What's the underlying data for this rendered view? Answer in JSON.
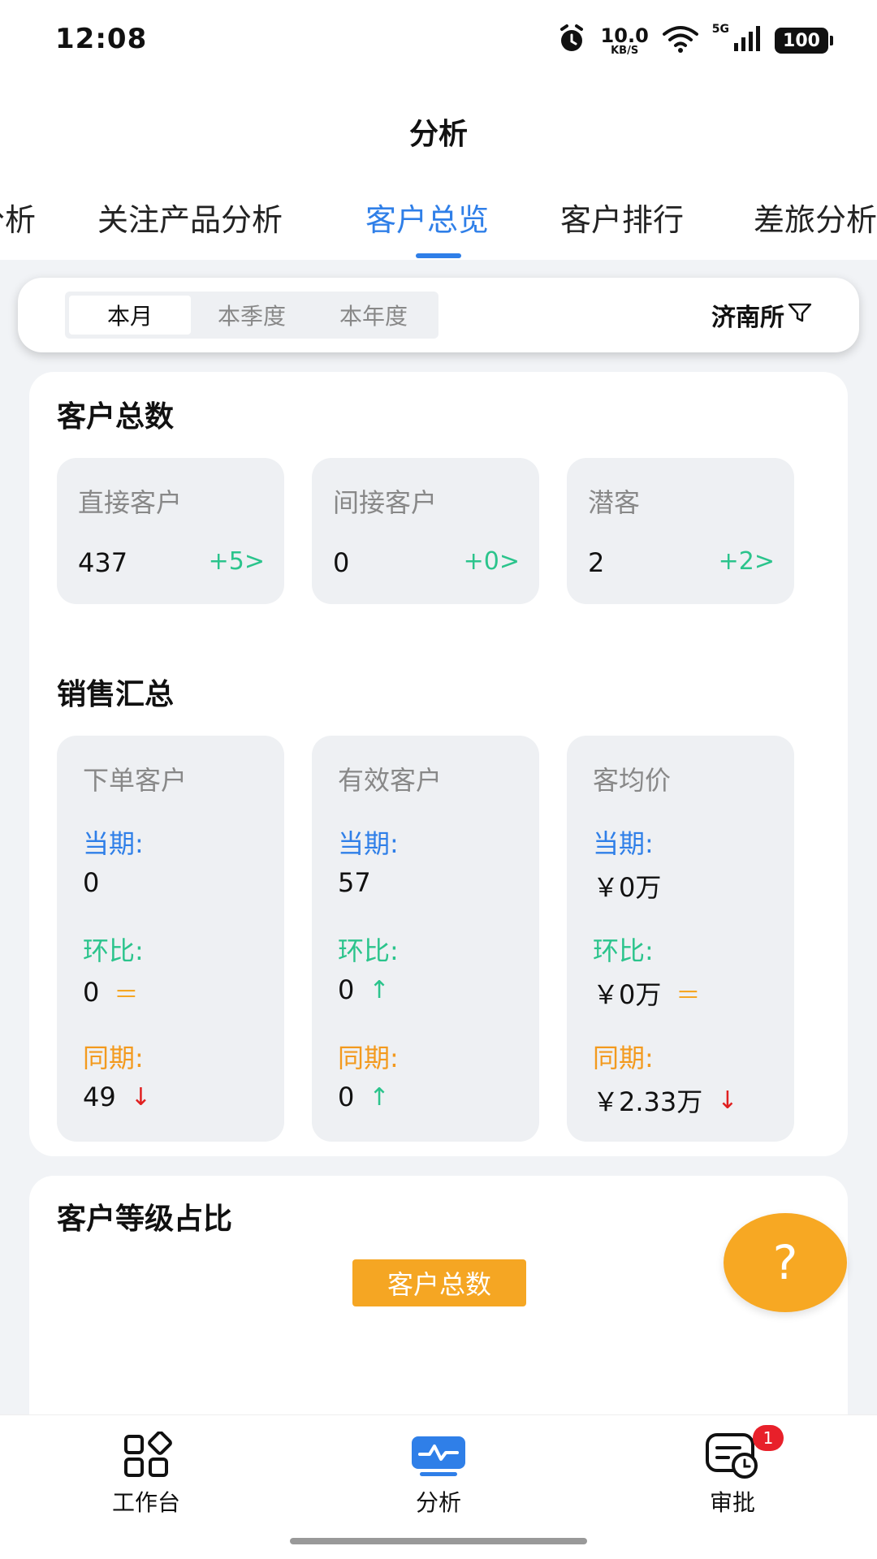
{
  "status_bar": {
    "time": "12:08",
    "net_speed_value": "10.0",
    "net_speed_unit": "KB/S",
    "signal_label": "5G",
    "battery": "100",
    "icons": [
      "alarm-icon",
      "wifi-icon",
      "signal-icon",
      "battery-icon"
    ]
  },
  "header": {
    "title": "分析",
    "tabs": [
      {
        "label": "分析",
        "active": false
      },
      {
        "label": "关注产品分析",
        "active": false
      },
      {
        "label": "客户总览",
        "active": true
      },
      {
        "label": "客户排行",
        "active": false
      },
      {
        "label": "差旅分析",
        "active": false
      }
    ]
  },
  "filter": {
    "periods": [
      "本月",
      "本季度",
      "本年度"
    ],
    "selected_period": "本月",
    "office": "济南所"
  },
  "customer_total": {
    "title": "客户总数",
    "items": [
      {
        "label": "直接客户",
        "value": "437",
        "delta": "+5>"
      },
      {
        "label": "间接客户",
        "value": "0",
        "delta": "+0>"
      },
      {
        "label": "潜客",
        "value": "2",
        "delta": "+2>"
      }
    ]
  },
  "sales_summary": {
    "title": "销售汇总",
    "current_label": "当期:",
    "mom_label": "环比:",
    "yoy_label": "同期:",
    "items": [
      {
        "label": "下单客户",
        "current": "0",
        "mom": "0",
        "mom_mark": "＝",
        "yoy": "49",
        "yoy_mark": "↓"
      },
      {
        "label": "有效客户",
        "current": "57",
        "mom": "0",
        "mom_mark": "↑",
        "yoy": "0",
        "yoy_mark": "↑"
      },
      {
        "label": "客均价",
        "current": "￥0万",
        "mom": "￥0万",
        "mom_mark": "＝",
        "yoy": "￥2.33万",
        "yoy_mark": "↓"
      }
    ]
  },
  "level_ratio": {
    "title": "客户等级占比",
    "legend": "客户总数"
  },
  "help_button": "?",
  "bottom_nav": {
    "items": [
      {
        "label": "工作台",
        "icon": "grid-icon"
      },
      {
        "label": "分析",
        "icon": "analysis-icon",
        "active": true
      },
      {
        "label": "审批",
        "icon": "approval-icon",
        "badge": "1"
      }
    ]
  },
  "colors": {
    "accent_blue": "#2f7fe8",
    "green": "#2bc48c",
    "orange": "#f39a1e",
    "red": "#e02020"
  }
}
